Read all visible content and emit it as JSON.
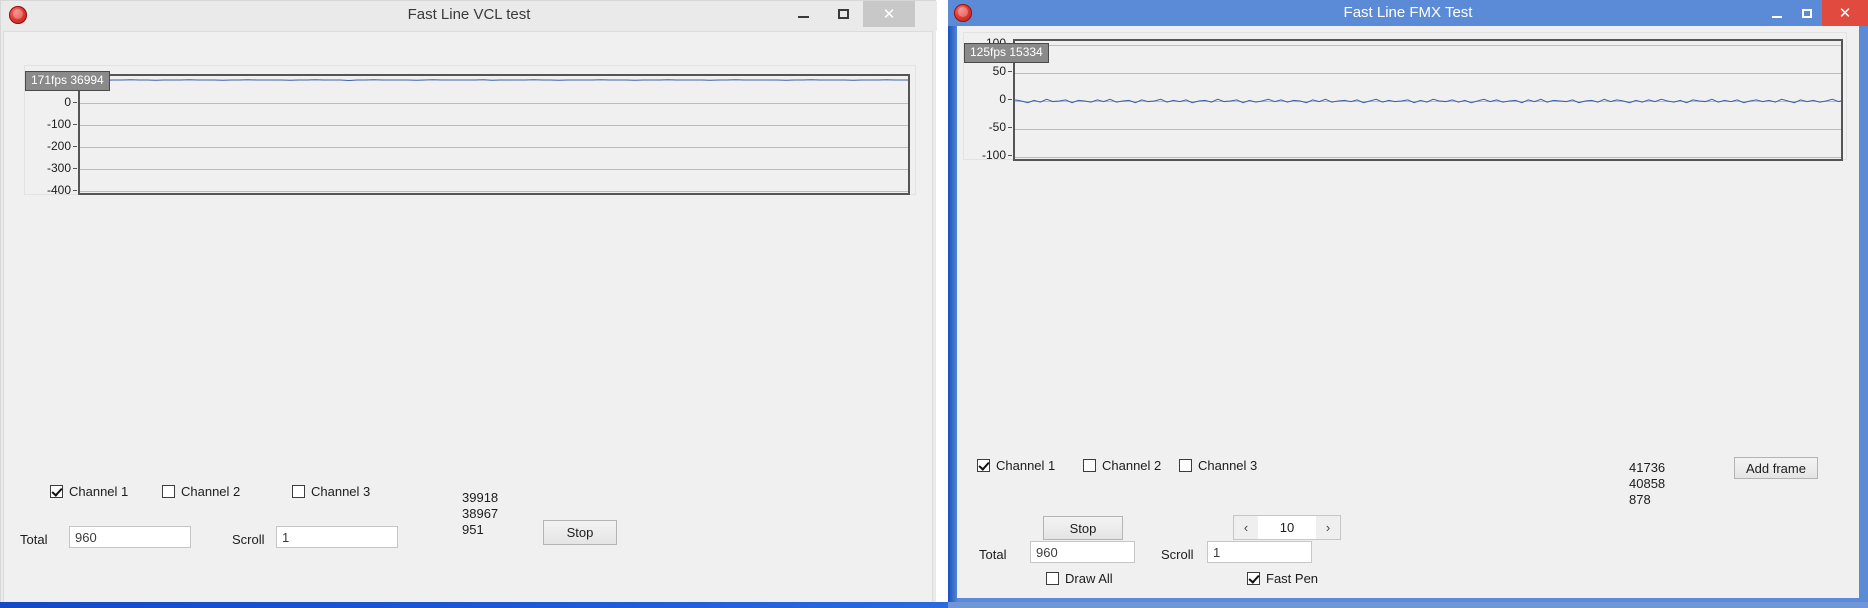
{
  "left_window": {
    "title": "Fast Line VCL test",
    "icon": "app-icon",
    "controls": {
      "minimize": "–",
      "maximize": "▢",
      "close": "✕"
    },
    "chart": {
      "tooltip": "171fps 36994",
      "y_labels": [
        "0",
        "-100",
        "-200",
        "-300",
        "-400"
      ]
    },
    "channels": [
      {
        "label": "Channel 1",
        "checked": true
      },
      {
        "label": "Channel 2",
        "checked": false
      },
      {
        "label": "Channel 3",
        "checked": false
      }
    ],
    "total_label": "Total",
    "total_value": "960",
    "scroll_label": "Scroll",
    "scroll_value": "1",
    "stats": [
      "39918",
      "38967",
      "951"
    ],
    "stop_button": "Stop"
  },
  "right_window": {
    "title": "Fast Line FMX Test",
    "icon": "app-icon",
    "controls": {
      "minimize": "–",
      "maximize": "▢",
      "close": "✕"
    },
    "chart": {
      "tooltip": "125fps 15334",
      "y_labels": [
        "100",
        "50",
        "0",
        "-50",
        "-100"
      ]
    },
    "channels": [
      {
        "label": "Channel 1",
        "checked": true
      },
      {
        "label": "Channel 2",
        "checked": false
      },
      {
        "label": "Channel 3",
        "checked": false
      }
    ],
    "total_label": "Total",
    "total_value": "960",
    "scroll_label": "Scroll",
    "scroll_value": "1",
    "stats": [
      "41736",
      "40858",
      "878"
    ],
    "stop_button": "Stop",
    "add_frame_button": "Add frame",
    "spinner_value": "10",
    "spinner_prev": "‹",
    "spinner_next": "›",
    "draw_all": {
      "label": "Draw All",
      "checked": false
    },
    "fast_pen": {
      "label": "Fast Pen",
      "checked": true
    }
  },
  "chart_data": [
    {
      "type": "line",
      "title": "Fast Line VCL test",
      "series": [
        {
          "name": "Channel 1",
          "color": "#3b5fa8",
          "values": [
            0,
            0,
            -2,
            -1,
            0,
            0,
            1,
            0,
            0,
            -1,
            0,
            0,
            0,
            1,
            0,
            0,
            0,
            -1,
            0,
            0,
            1,
            0,
            0,
            0,
            0,
            -1,
            0,
            0,
            1,
            0,
            0,
            0,
            -2,
            0,
            0,
            1,
            0,
            0,
            0,
            0,
            -1,
            0,
            1,
            0,
            0,
            0,
            0,
            0,
            1,
            -1,
            0,
            0,
            0,
            0,
            1,
            0,
            0,
            -1,
            0,
            0,
            0,
            0,
            1,
            0,
            0,
            0,
            -1,
            0,
            0,
            0,
            1,
            0,
            0,
            0,
            0,
            -1,
            0,
            0,
            1,
            0,
            0,
            0,
            0,
            0,
            -1,
            0,
            0,
            1,
            0,
            0,
            0,
            0,
            -1,
            0,
            0,
            0,
            1,
            0,
            0,
            0
          ]
        }
      ],
      "ylabel": "",
      "xlabel": "",
      "ylim": [
        -450,
        20
      ],
      "yticks": [
        0,
        -100,
        -200,
        -300,
        -400
      ],
      "grid": true,
      "legend": "none",
      "annotation": "171fps 36994"
    },
    {
      "type": "line",
      "title": "Fast Line FMX Test",
      "series": [
        {
          "name": "Channel 1",
          "color": "#3b5fa8",
          "values": [
            2,
            0,
            -3,
            1,
            -2,
            3,
            -1,
            0,
            2,
            -3,
            1,
            0,
            -2,
            2,
            -1,
            3,
            -2,
            0,
            1,
            -3,
            2,
            -1,
            0,
            3,
            -2,
            1,
            -1,
            2,
            -3,
            0,
            1,
            -2,
            3,
            -1,
            0,
            2,
            -3,
            1,
            -2,
            0,
            3,
            -1,
            2,
            -2,
            1,
            0,
            -3,
            2,
            -1,
            3,
            -2,
            0,
            1,
            -1,
            2,
            -3,
            0,
            3,
            -2,
            1,
            -1,
            0,
            2,
            -3,
            1,
            -2,
            3,
            0,
            -1,
            2,
            -2,
            1,
            -3,
            0,
            3,
            -1,
            2,
            -2,
            0,
            1,
            -3,
            2,
            -1,
            3,
            -2,
            1,
            0,
            -1,
            2,
            -3,
            0,
            1,
            -2,
            3,
            -1,
            2,
            0,
            -3,
            1,
            -2,
            2,
            -1,
            3,
            0,
            -2,
            1,
            -3,
            2,
            0,
            -1,
            3,
            -2,
            1,
            -1,
            2,
            -3,
            0,
            2,
            -1,
            1,
            -2,
            3,
            0,
            -3,
            2,
            -1,
            1,
            -2,
            0,
            3,
            -1,
            2
          ]
        }
      ],
      "ylabel": "",
      "xlabel": "",
      "ylim": [
        -110,
        110
      ],
      "yticks": [
        100,
        50,
        0,
        -50,
        -100
      ],
      "grid": true,
      "legend": "none",
      "annotation": "125fps 15334"
    }
  ]
}
